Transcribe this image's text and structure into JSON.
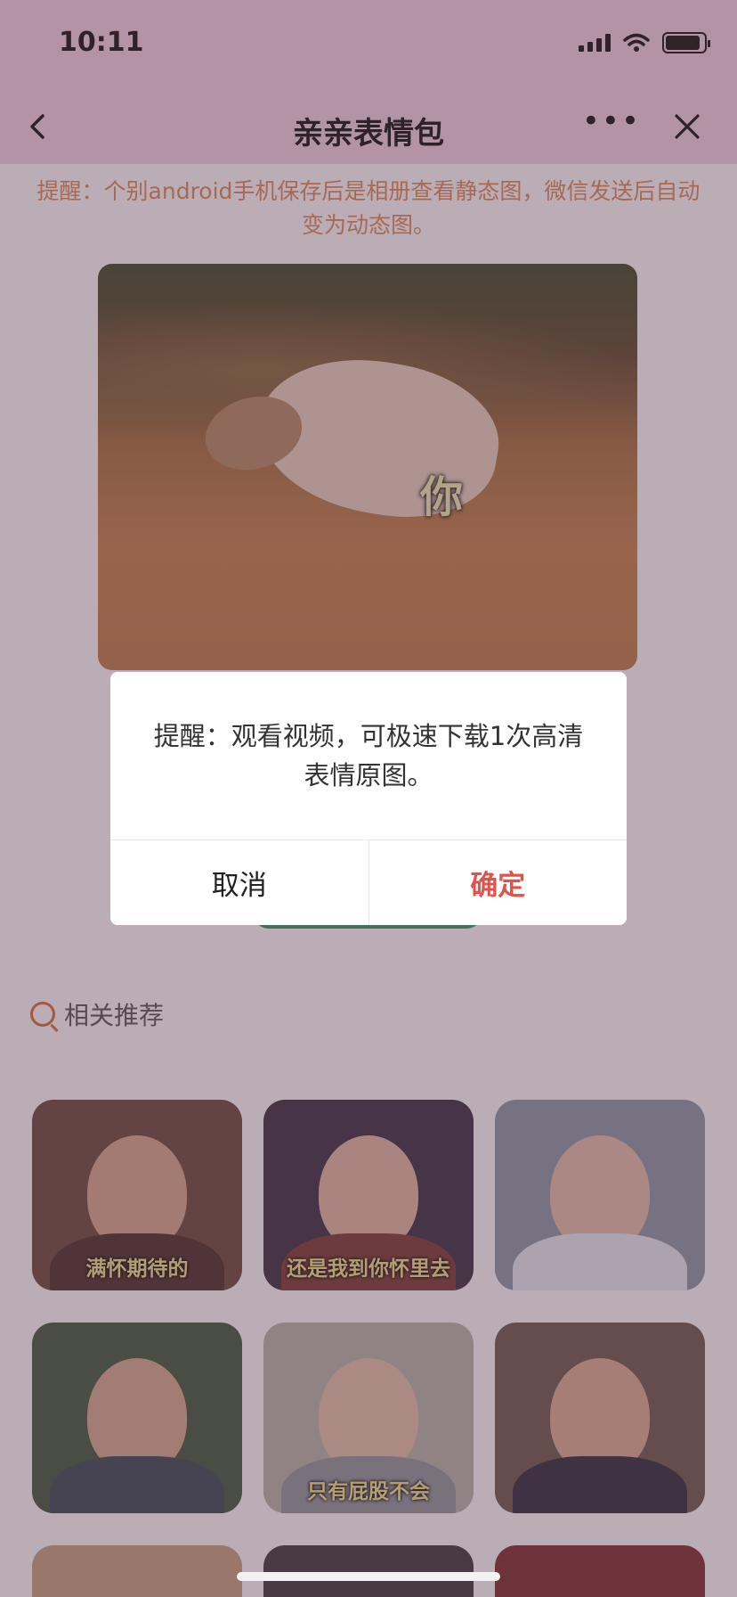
{
  "status_bar": {
    "time": "10:11",
    "battery_level": 0.9
  },
  "navbar": {
    "title": "亲亲表情包"
  },
  "notice": "提醒：个别android手机保存后是相册查看静态图，微信发送后自动变为动态图。",
  "hero": {
    "caption": "你"
  },
  "related": {
    "title": "相关推荐",
    "tiles": [
      {
        "caption": "满怀期待的",
        "bg": "#6b4a3a",
        "face": "#d9a98a",
        "body": "#4a3026"
      },
      {
        "caption": "还是我到你怀里去",
        "bg": "#3a2f3f",
        "face": "#e3b9a0",
        "body": "#7a3c30"
      },
      {
        "caption": "",
        "bg": "#8a9aa6",
        "face": "#e6c0a8",
        "body": "#e9eef2"
      },
      {
        "caption": "",
        "bg": "#3e5a3c",
        "face": "#d6ac92",
        "body": "#3a4a52"
      },
      {
        "caption": "只有屁股不会",
        "bg": "#b7b7aa",
        "face": "#e5c3a7",
        "body": "#8f9a9e"
      },
      {
        "caption": "",
        "bg": "#6f5a4b",
        "face": "#dcae8f",
        "body": "#2b2b3a"
      }
    ],
    "partial_tiles": [
      {
        "bg": "#c9a27f"
      },
      {
        "bg": "#3c3c3c"
      },
      {
        "bg": "#7c2e2a"
      }
    ]
  },
  "modal": {
    "message": "提醒：观看视频，可极速下载1次高清表情原图。",
    "cancel_label": "取消",
    "confirm_label": "确定"
  }
}
